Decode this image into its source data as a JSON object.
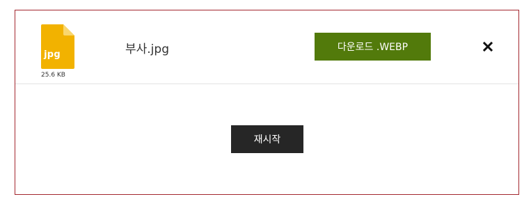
{
  "file": {
    "extension": "jpg",
    "size": "25.6 KB",
    "name": "부사.jpg",
    "download_label": "다운로드 .WEBP",
    "close_icon": "close-icon"
  },
  "actions": {
    "restart_label": "재시작"
  },
  "colors": {
    "frame_border": "#a3262e",
    "file_icon": "#f2b200",
    "download_button": "#527a0b",
    "restart_button": "#262626"
  }
}
